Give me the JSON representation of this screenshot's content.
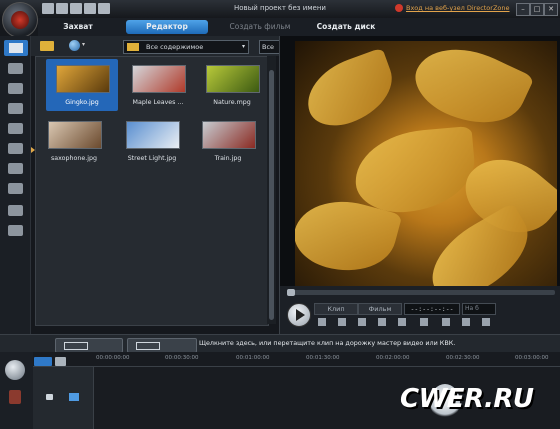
{
  "window": {
    "project_title": "Новый проект без имени",
    "login_link": "Вход на веб-узел DirectorZone",
    "controls": [
      "–",
      "□",
      "✕"
    ]
  },
  "mode_tabs": [
    {
      "label": "Захват",
      "state": "normal"
    },
    {
      "label": "Редактор",
      "state": "active"
    },
    {
      "label": "Создать фильм",
      "state": "disabled"
    },
    {
      "label": "Создать диск",
      "state": "normal"
    }
  ],
  "tools": [
    {
      "name": "media-room-icon",
      "active": true
    },
    {
      "name": "effects-room-icon"
    },
    {
      "name": "pip-objects-icon"
    },
    {
      "name": "particle-room-icon"
    },
    {
      "name": "title-room-icon"
    },
    {
      "name": "transition-room-icon"
    },
    {
      "name": "audio-mixing-icon"
    },
    {
      "name": "voiceover-icon"
    },
    {
      "name": "chapter-room-icon"
    },
    {
      "name": "subtitle-room-icon"
    }
  ],
  "media_toolbar": {
    "filter_value": "Все содержимое",
    "all_label": "Все"
  },
  "media": [
    {
      "label": "Gingko.jpg",
      "selected": true,
      "colors": [
        "#e0a63a",
        "#5a3a0c"
      ]
    },
    {
      "label": "Maple Leaves ...",
      "selected": false,
      "colors": [
        "#d4d6da",
        "#b03a2a"
      ]
    },
    {
      "label": "Nature.mpg",
      "selected": false,
      "colors": [
        "#b8c93a",
        "#3c5a12"
      ]
    },
    {
      "label": "saxophone.jpg",
      "selected": false,
      "colors": [
        "#d9c7b2",
        "#6b4a2e"
      ]
    },
    {
      "label": "Street Light.jpg",
      "selected": false,
      "colors": [
        "#5a8fd0",
        "#e9eef3"
      ]
    },
    {
      "label": "Train.jpg",
      "selected": false,
      "colors": [
        "#c7ccd1",
        "#8a2a22"
      ]
    }
  ],
  "playback": {
    "clip_label": "Клип",
    "movie_label": "Фильм",
    "timecode": "--:--:--:--",
    "ratio": "На б"
  },
  "storyboard": {
    "hint": "Щелкните здесь, или перетащите клип на дорожку мастер видео или КВК."
  },
  "timeline_ticks": [
    "00:00:00:00",
    "00:00:30:00",
    "00:01:00:00",
    "00:01:30:00",
    "00:02:00:00",
    "00:02:30:00",
    "00:03:00:00"
  ],
  "watermark": "CWER.RU"
}
